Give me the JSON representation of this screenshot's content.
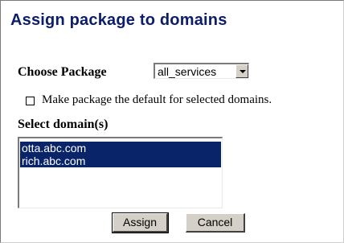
{
  "dialog": {
    "title": "Assign package to domains"
  },
  "package": {
    "label": "Choose Package",
    "selected": "all_services"
  },
  "default_option": {
    "label": "Make package the default for selected domains.",
    "checked": false
  },
  "domains": {
    "label": "Select domain(s)",
    "items": [
      {
        "label": "otta.abc.com",
        "selected": true
      },
      {
        "label": "rich.abc.com",
        "selected": true
      }
    ]
  },
  "buttons": {
    "assign": "Assign",
    "cancel": "Cancel"
  },
  "colors": {
    "title": "#0b1d6b",
    "selection": "#0a246a",
    "button_face": "#d4d0c8"
  },
  "icons": {
    "dropdown": "chevron-down-icon"
  }
}
